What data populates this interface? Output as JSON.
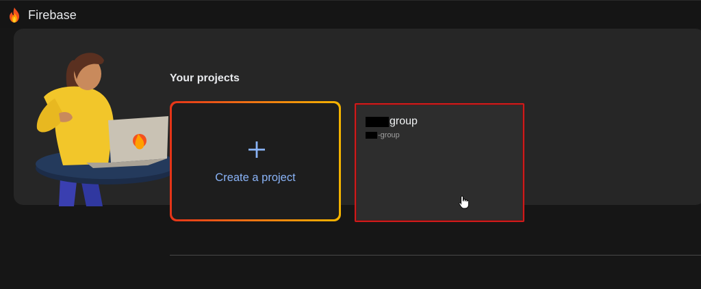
{
  "app": {
    "name": "Firebase",
    "icon": "firebase-flame-icon",
    "accent": "#8ab4f8"
  },
  "projects_section": {
    "title": "Your projects",
    "create_card": {
      "icon": "plus-icon",
      "label": "Create a project"
    },
    "projects": [
      {
        "name_suffix": "group",
        "id_suffix": "-group",
        "selected_border": "#d11a1a"
      }
    ]
  },
  "colors": {
    "background": "#161616",
    "panel": "#262626",
    "card": "#1d1d1d",
    "project_card": "#2d2d2d"
  }
}
